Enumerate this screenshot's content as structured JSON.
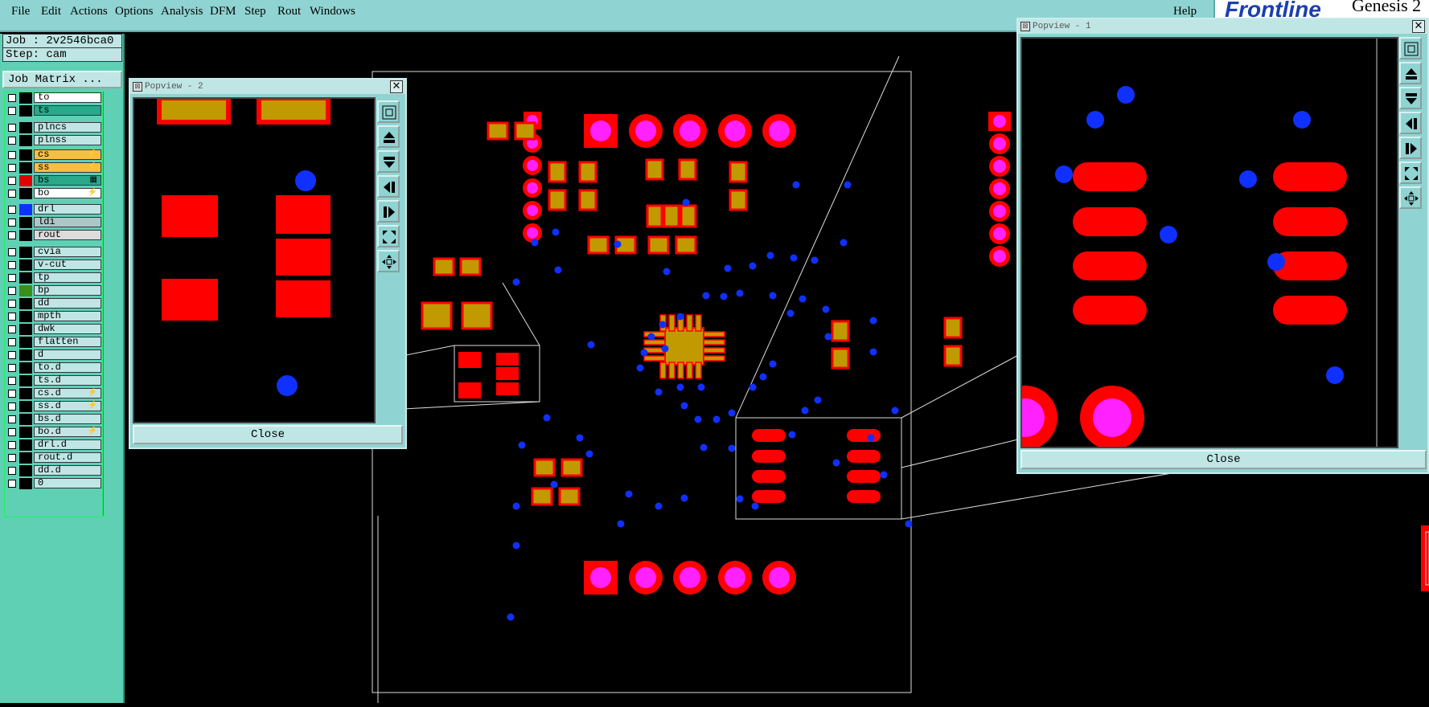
{
  "menu": [
    {
      "label": "File",
      "key": "F"
    },
    {
      "label": "Edit",
      "key": "E"
    },
    {
      "label": "Actions",
      "key": "A"
    },
    {
      "label": "Options",
      "key": "O"
    },
    {
      "label": "Analysis",
      "key": "A"
    },
    {
      "label": "DFM",
      "key": "D"
    },
    {
      "label": "Step",
      "key": "S"
    },
    {
      "label": "Rout",
      "key": "R"
    },
    {
      "label": "Windows",
      "key": "W"
    }
  ],
  "help_label": "Help",
  "logo": {
    "brand": "Frontline",
    "product": "Genesis 2"
  },
  "job_info": {
    "job": "Job : 2v2546bca0",
    "step": "Step: cam",
    "matrix_button": "Job Matrix ..."
  },
  "layers": [
    {
      "name": "to",
      "color": "#000000",
      "bg": "#ffffff"
    },
    {
      "name": "ts",
      "color": "#000000",
      "bg": "#2aa88a"
    },
    {
      "name": "plncs",
      "color": "#000000",
      "bg": "#bfe6e4"
    },
    {
      "name": "plnss",
      "color": "#000000",
      "bg": "#bfe6e4"
    },
    {
      "name": "cs",
      "color": "#000000",
      "bg": "#f5c040",
      "mark": "⚡"
    },
    {
      "name": "ss",
      "color": "#000000",
      "bg": "#f5c040",
      "mark": "⚡"
    },
    {
      "name": "bs",
      "color": "#e00000",
      "bg": "#2aa88a",
      "mark": "▦"
    },
    {
      "name": "bo",
      "color": "#000000",
      "bg": "#ffffff",
      "mark": "⚡"
    },
    {
      "name": "drl",
      "color": "#1030ff",
      "bg": "#bfe6e4"
    },
    {
      "name": "ldi",
      "color": "#000000",
      "bg": "#a9c8c8"
    },
    {
      "name": "rout",
      "color": "#000000",
      "bg": "#dcdcdc"
    },
    {
      "name": "cvia",
      "color": "#000000",
      "bg": "#bfe6e4"
    },
    {
      "name": "v-cut",
      "color": "#000000",
      "bg": "#bfe6e4"
    },
    {
      "name": "tp",
      "color": "#000000",
      "bg": "#bfe6e4"
    },
    {
      "name": "bp",
      "color": "#3a8f1a",
      "bg": "#bfe6e4"
    },
    {
      "name": "dd",
      "color": "#000000",
      "bg": "#bfe6e4"
    },
    {
      "name": "mpth",
      "color": "#000000",
      "bg": "#bfe6e4"
    },
    {
      "name": "dwk",
      "color": "#000000",
      "bg": "#bfe6e4"
    },
    {
      "name": "flatten",
      "color": "#000000",
      "bg": "#bfe6e4"
    },
    {
      "name": "d",
      "color": "#000000",
      "bg": "#bfe6e4"
    },
    {
      "name": "to.d",
      "color": "#000000",
      "bg": "#bfe6e4"
    },
    {
      "name": "ts.d",
      "color": "#000000",
      "bg": "#bfe6e4"
    },
    {
      "name": "cs.d",
      "color": "#000000",
      "bg": "#bfe6e4",
      "mark": "⚡"
    },
    {
      "name": "ss.d",
      "color": "#000000",
      "bg": "#bfe6e4",
      "mark": "⚡"
    },
    {
      "name": "bs.d",
      "color": "#000000",
      "bg": "#bfe6e4"
    },
    {
      "name": "bo.d",
      "color": "#000000",
      "bg": "#bfe6e4",
      "mark": "⚡"
    },
    {
      "name": "drl.d",
      "color": "#000000",
      "bg": "#bfe6e4"
    },
    {
      "name": "rout.d",
      "color": "#000000",
      "bg": "#bfe6e4"
    },
    {
      "name": "dd.d",
      "color": "#000000",
      "bg": "#bfe6e4"
    },
    {
      "name": "0",
      "color": "#000000",
      "bg": "#bfe6e4"
    }
  ],
  "popview2": {
    "title": "Popview - 2",
    "close": "Close"
  },
  "popview1": {
    "title": "Popview - 1",
    "close": "Close"
  },
  "toolbar_icons": [
    "zoom-fit-icon",
    "pan-up-icon",
    "pan-down-icon",
    "pan-left-icon",
    "pan-right-icon",
    "zoom-in-icon",
    "zoom-out-icon"
  ],
  "colors": {
    "pad": "#ff0000",
    "gold": "#c09a00",
    "magenta": "#ff22ff",
    "drill": "#1030ff",
    "panel": "#8fd4d2",
    "field": "#bfe6e4"
  }
}
